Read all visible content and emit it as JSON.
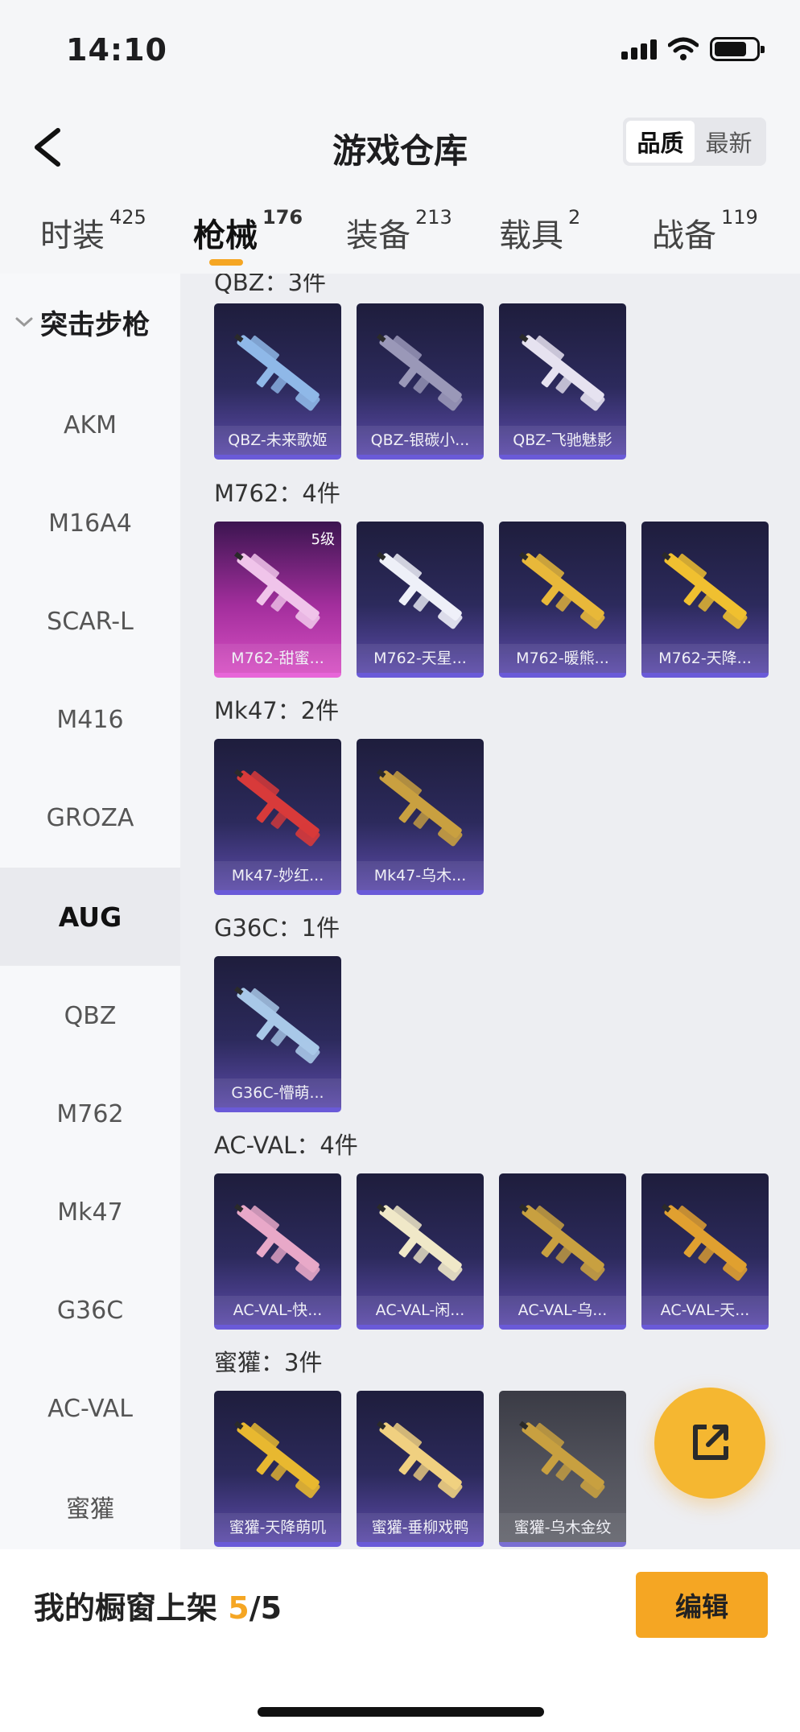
{
  "status": {
    "time": "14:10"
  },
  "header": {
    "title": "游戏仓库",
    "sort_options": [
      "品质",
      "最新"
    ],
    "sort_active": "品质"
  },
  "tabs": [
    {
      "label": "时装",
      "count": "425"
    },
    {
      "label": "枪械",
      "count": "176"
    },
    {
      "label": "装备",
      "count": "213"
    },
    {
      "label": "载具",
      "count": "2"
    },
    {
      "label": "战备",
      "count": "119"
    }
  ],
  "active_tab": "枪械",
  "sidebar": {
    "group": "突击步枪",
    "items": [
      "AKM",
      "M16A4",
      "SCAR-L",
      "M416",
      "GROZA",
      "AUG",
      "QBZ",
      "M762",
      "Mk47",
      "G36C",
      "AC-VAL",
      "蜜獾"
    ],
    "active": "AUG"
  },
  "sections": [
    {
      "title": "QBZ：3件",
      "cards": [
        {
          "name": "QBZ-未来歌姬",
          "color": "#8fb8e8"
        },
        {
          "name": "QBZ-银碳小...",
          "color": "#9a98b8"
        },
        {
          "name": "QBZ-飞驰魅影",
          "color": "#e6e2f0"
        }
      ]
    },
    {
      "title": "M762：4件",
      "cards": [
        {
          "name": "M762-甜蜜...",
          "color": "#f0c4ea",
          "level": "5级",
          "style": "pink"
        },
        {
          "name": "M762-天星...",
          "color": "#eef0f8"
        },
        {
          "name": "M762-暖熊...",
          "color": "#e8b83a"
        },
        {
          "name": "M762-天降...",
          "color": "#f0c030"
        }
      ]
    },
    {
      "title": "Mk47：2件",
      "cards": [
        {
          "name": "Mk47-妙红...",
          "color": "#d83a3a"
        },
        {
          "name": "Mk47-乌木...",
          "color": "#c9a040"
        }
      ]
    },
    {
      "title": "G36C：1件",
      "cards": [
        {
          "name": "G36C-懵萌...",
          "color": "#a8c8e8"
        }
      ]
    },
    {
      "title": "AC-VAL：4件",
      "cards": [
        {
          "name": "AC-VAL-快...",
          "color": "#e8a8c8"
        },
        {
          "name": "AC-VAL-闲...",
          "color": "#f0e8c8"
        },
        {
          "name": "AC-VAL-乌...",
          "color": "#c8a040"
        },
        {
          "name": "AC-VAL-天...",
          "color": "#e0a030"
        }
      ]
    },
    {
      "title": "蜜獾：3件",
      "cards": [
        {
          "name": "蜜獾-天降萌叽",
          "color": "#e8b830"
        },
        {
          "name": "蜜獾-垂柳戏鸭",
          "color": "#f0d080"
        },
        {
          "name": "蜜獾-乌木金纹",
          "color": "#c8a040",
          "style": "gray"
        }
      ]
    }
  ],
  "footer": {
    "label": "我的橱窗上架",
    "current": "5",
    "sep_total": "/5",
    "edit_label": "编辑"
  }
}
